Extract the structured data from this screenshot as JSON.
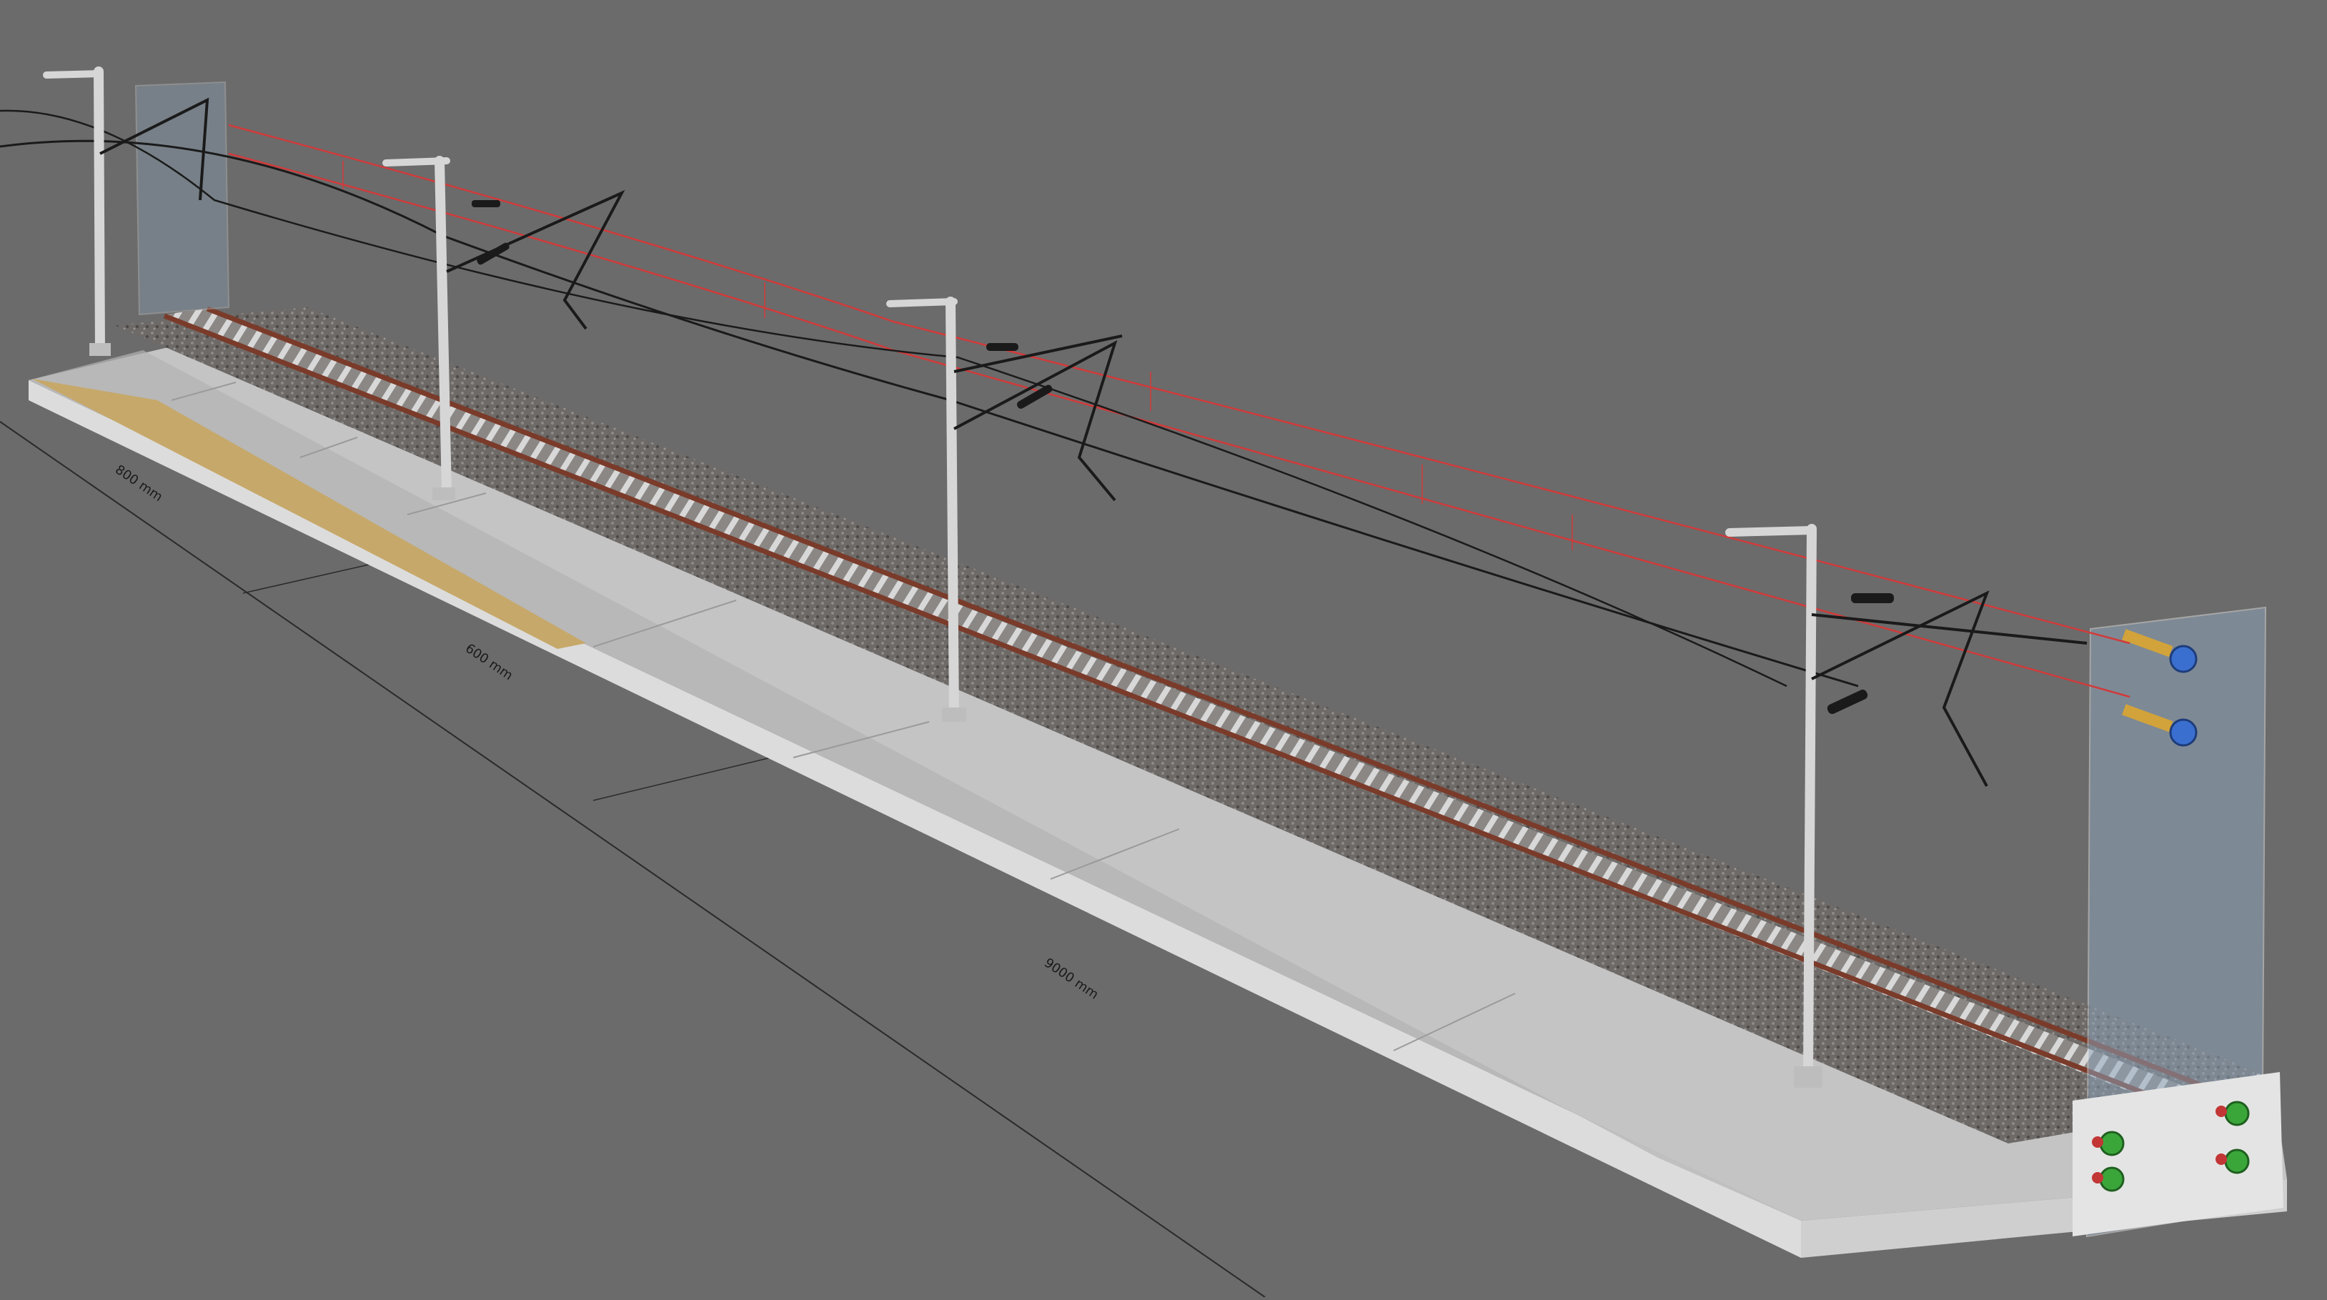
{
  "scene": {
    "dimension_labels": [
      "800 mm",
      "600 mm",
      "9000 mm"
    ]
  },
  "colors": {
    "background": "#6b6b6b",
    "platform_top": "#bdbdbd",
    "platform_side": "#e2e2e2",
    "ballast": "#6e6a68",
    "rail": "#7a3b2a",
    "sleepers": "#cfcfcf",
    "mast": "#cfcfcf",
    "contact_wire_red": "#d23a3a",
    "bolt_green": "#3aa63a",
    "bolt_blue": "#3b6fcf",
    "glass_panel": "#8fa7bf"
  }
}
